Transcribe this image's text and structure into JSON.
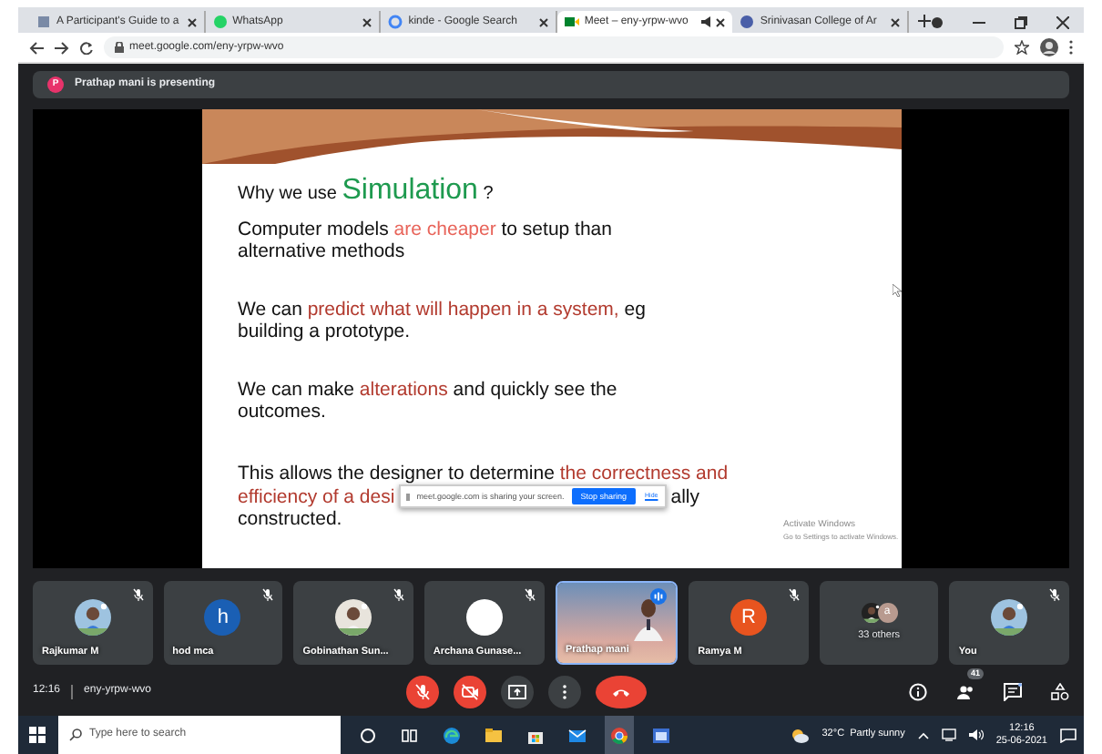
{
  "browser": {
    "tabs": [
      {
        "title": "A Participant's Guide to a",
        "selected": false
      },
      {
        "title": "WhatsApp",
        "selected": false
      },
      {
        "title": "kinde - Google Search",
        "selected": false
      },
      {
        "title": "Meet – eny-yrpw-wvo",
        "selected": true
      },
      {
        "title": "Srinivasan College of Ar",
        "selected": false
      }
    ],
    "address": "meet.google.com/eny-yrpw-wvo"
  },
  "banner": {
    "letter": "P",
    "text": "Prathap mani is presenting"
  },
  "slide": {
    "title": [
      {
        "text": "Why we use "
      },
      {
        "text": "Simulation",
        "color": "#1e9a4f"
      },
      {
        "text": " ?"
      }
    ],
    "paragraphs": [
      {
        "lines": [
          [
            {
              "text": "Computer models "
            },
            {
              "text": "are cheaper",
              "color": "#e8645a"
            },
            {
              "text": " to setup than"
            }
          ],
          [
            {
              "text": "alternative methods"
            }
          ]
        ]
      },
      {
        "lines": [
          [
            {
              "text": "We can "
            },
            {
              "text": "predict what will happen in a system,",
              "color": "#b23a2e"
            },
            {
              "text": " eg"
            }
          ],
          [
            {
              "text": "building a prototype."
            }
          ]
        ]
      },
      {
        "lines": [
          [
            {
              "text": "We can make "
            },
            {
              "text": "alterations",
              "color": "#b23a2e"
            },
            {
              "text": " and quickly see the"
            }
          ],
          [
            {
              "text": "outcomes."
            }
          ]
        ]
      }
    ],
    "last": {
      "line1": [
        {
          "text": "This allows the designer to determine "
        },
        {
          "text": "the correctness and",
          "color": "#b23a2e"
        }
      ],
      "line2_before": "efficiency of a desi",
      "line2_after": "ally",
      "line3": "constructed."
    },
    "share_bar": {
      "message": "meet.google.com is sharing your screen.",
      "stop": "Stop sharing",
      "hide": "Hide"
    },
    "activation": {
      "title": "Activate Windows",
      "subtitle": "Go to Settings to activate Windows."
    }
  },
  "participants": [
    {
      "name": "Rajkumar M",
      "muted": true,
      "speaking": false
    },
    {
      "name": "hod mca",
      "kind": "letter",
      "letter": "h",
      "color": "#1a5fb4",
      "muted": true,
      "speaking": false
    },
    {
      "name": "Gobinathan Sun...",
      "muted": true,
      "speaking": false
    },
    {
      "name": "Archana Gunase...",
      "kind": "blank",
      "muted": true,
      "speaking": false
    },
    {
      "name": "Prathap mani",
      "kind": "video",
      "muted": false,
      "speaking": true
    },
    {
      "name": "Ramya M",
      "kind": "letter",
      "letter": "R",
      "color": "#e8541f",
      "muted": true,
      "speaking": false
    },
    {
      "name": "33 others",
      "kind": "group",
      "letter": "a",
      "color": "#b89a8f",
      "muted": false,
      "speaking": false
    },
    {
      "name": "You",
      "muted": true,
      "speaking": false
    }
  ],
  "controls": {
    "time": "12:16",
    "code": "eny-yrpw-wvo",
    "buttons": [
      {
        "kind": "mic",
        "on": false
      },
      {
        "kind": "camera",
        "on": false
      },
      {
        "kind": "present"
      },
      {
        "kind": "more"
      },
      {
        "kind": "hangup"
      }
    ],
    "panel": [
      {
        "kind": "info"
      },
      {
        "kind": "people",
        "badge": "41"
      },
      {
        "kind": "chat"
      },
      {
        "kind": "activities"
      }
    ]
  },
  "taskbar": {
    "search": "Type here to search",
    "apps": [
      {
        "kind": "cortana",
        "selected": false
      },
      {
        "kind": "taskview",
        "selected": false
      },
      {
        "kind": "edge",
        "selected": false
      },
      {
        "kind": "explorer",
        "selected": false
      },
      {
        "kind": "store",
        "selected": false
      },
      {
        "kind": "mail",
        "selected": false
      },
      {
        "kind": "chrome",
        "selected": true
      },
      {
        "kind": "window",
        "selected": false
      }
    ],
    "weather": "32°C  Partly sunny",
    "time": "12:16",
    "date": "25-06-2021"
  }
}
